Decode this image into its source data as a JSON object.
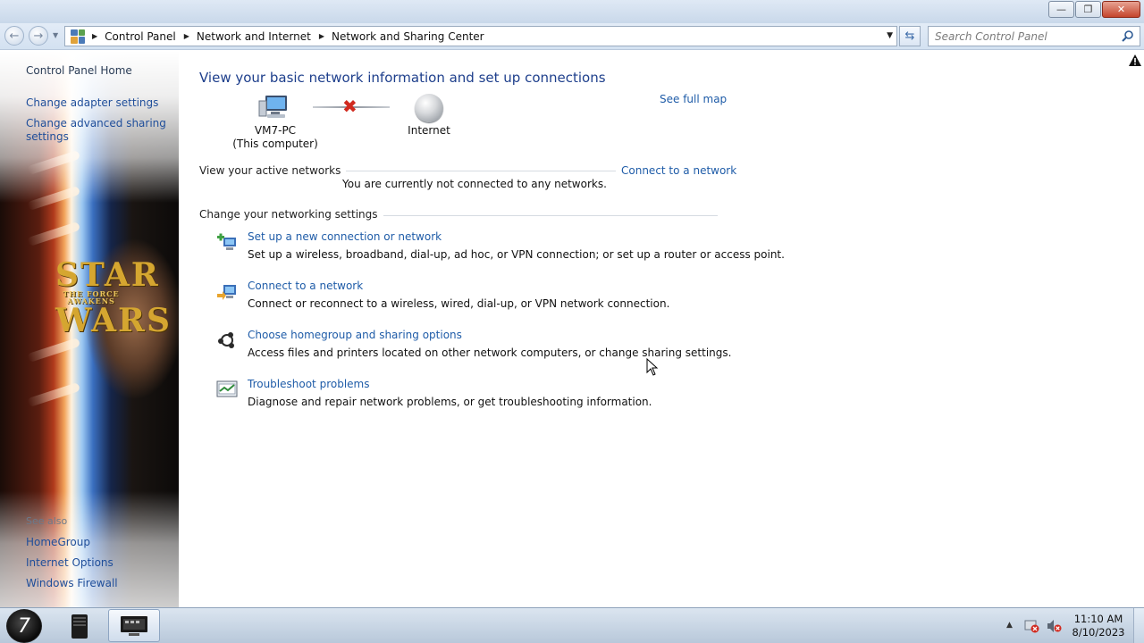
{
  "window": {
    "controls": {
      "minimize": "—",
      "maximize": "❐",
      "close": "✕"
    }
  },
  "address": {
    "breadcrumbs": [
      "Control Panel",
      "Network and Internet",
      "Network and Sharing Center"
    ],
    "search_placeholder": "Search Control Panel"
  },
  "sidebar": {
    "links": [
      "Control Panel Home",
      "Change adapter settings",
      "Change advanced sharing",
      "settings"
    ],
    "see_also_label": "See also",
    "see_also": [
      "HomeGroup",
      "Internet Options",
      "Windows Firewall"
    ],
    "wallpaper": {
      "big_top": "STAR",
      "small": "THE FORCE AWAKENS",
      "big_bottom": "WARS"
    }
  },
  "main": {
    "title": "View your basic network information and set up connections",
    "see_full_map": "See full map",
    "computer_name": "VM7-PC",
    "computer_sub": "(This computer)",
    "internet_label": "Internet",
    "active_networks_label": "View your active networks",
    "connect_to_network": "Connect to a network",
    "not_connected": "You are currently not connected to any networks.",
    "change_settings_label": "Change your networking settings",
    "tasks": [
      {
        "link": "Set up a new connection or network",
        "desc": "Set up a wireless, broadband, dial-up, ad hoc, or VPN connection; or set up a router or access point."
      },
      {
        "link": "Connect to a network",
        "desc": "Connect or reconnect to a wireless, wired, dial-up, or VPN network connection."
      },
      {
        "link": "Choose homegroup and sharing options",
        "desc": "Access files and printers located on other network computers, or change sharing settings."
      },
      {
        "link": "Troubleshoot problems",
        "desc": "Diagnose and repair network problems, or get troubleshooting information."
      }
    ]
  },
  "taskbar": {
    "time": "11:10 AM",
    "date": "8/10/2023"
  },
  "colors": {
    "link": "#1f5ca8",
    "title": "#1e3f8c",
    "error_x": "#d12a1f"
  }
}
